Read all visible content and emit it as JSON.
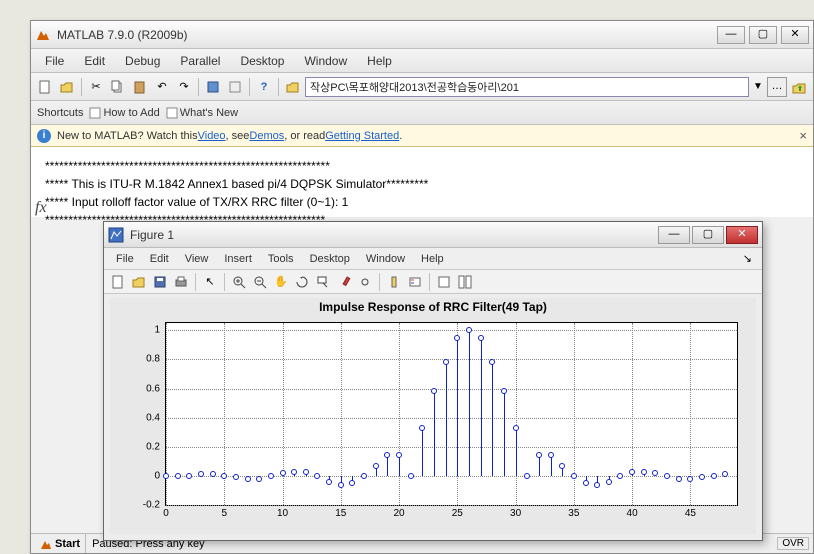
{
  "main_window": {
    "title": "MATLAB  7.9.0 (R2009b)",
    "menus": [
      "File",
      "Edit",
      "Debug",
      "Parallel",
      "Desktop",
      "Window",
      "Help"
    ],
    "toolbar_icons": [
      "new-file",
      "open",
      "cut",
      "copy",
      "paste",
      "undo",
      "redo",
      "help",
      "folder",
      "jackpot"
    ],
    "path": "작상PC\\목포해양대2013\\전공학습동아리\\201",
    "shortcuts_label": "Shortcuts",
    "how_to_add": "How to Add",
    "whats_new": "What's New",
    "info_new": "New to MATLAB? Watch this ",
    "info_video": "Video",
    "info_see": ", see ",
    "info_demos": "Demos",
    "info_or": ", or read ",
    "info_getting_started": "Getting Started",
    "info_period": ".",
    "console_lines": {
      "l1": "*************************************************************",
      "l2": "***** This is ITU-R M.1842 Annex1 based pi/4 DQPSK Simulator*********",
      "l3": "***** Input rolloff factor value of TX/RX RRC filter (0~1): 1",
      "l4": "************************************************************"
    },
    "start": "Start",
    "status_text": "Paused: Press any key",
    "ovr": "OVR"
  },
  "figure_window": {
    "title": "Figure 1",
    "menus": [
      "File",
      "Edit",
      "View",
      "Insert",
      "Tools",
      "Desktop",
      "Window",
      "Help"
    ]
  },
  "chart_data": {
    "type": "stem",
    "title": "Impulse Response of RRC Filter(49 Tap)",
    "xlabel": "",
    "ylabel": "",
    "xlim": [
      0,
      49
    ],
    "ylim": [
      -0.2,
      1.05
    ],
    "xticks": [
      0,
      5,
      10,
      15,
      20,
      25,
      30,
      35,
      40,
      45
    ],
    "yticks": [
      -0.2,
      0,
      0.2,
      0.4,
      0.6,
      0.8,
      1
    ],
    "x": [
      0,
      1,
      2,
      3,
      4,
      5,
      6,
      7,
      8,
      9,
      10,
      11,
      12,
      13,
      14,
      15,
      16,
      17,
      18,
      19,
      20,
      21,
      22,
      23,
      24,
      25,
      26,
      27,
      28,
      29,
      30,
      31,
      32,
      33,
      34,
      35,
      36,
      37,
      38,
      39,
      40,
      41,
      42,
      43,
      44,
      45,
      46,
      47,
      48
    ],
    "y": [
      0.0,
      0.0,
      0.0,
      0.01,
      0.01,
      0.0,
      -0.01,
      -0.02,
      -0.02,
      0.0,
      0.02,
      0.03,
      0.03,
      0.0,
      -0.04,
      -0.06,
      -0.05,
      0.0,
      0.07,
      0.14,
      0.14,
      0.0,
      0.33,
      0.58,
      0.78,
      0.95,
      1.0,
      0.95,
      0.78,
      0.58,
      0.33,
      0.0,
      0.14,
      0.14,
      0.07,
      0.0,
      -0.05,
      -0.06,
      -0.04,
      0.0,
      0.03,
      0.03,
      0.02,
      0.0,
      -0.02,
      -0.02,
      -0.01,
      0.0,
      0.01
    ]
  }
}
